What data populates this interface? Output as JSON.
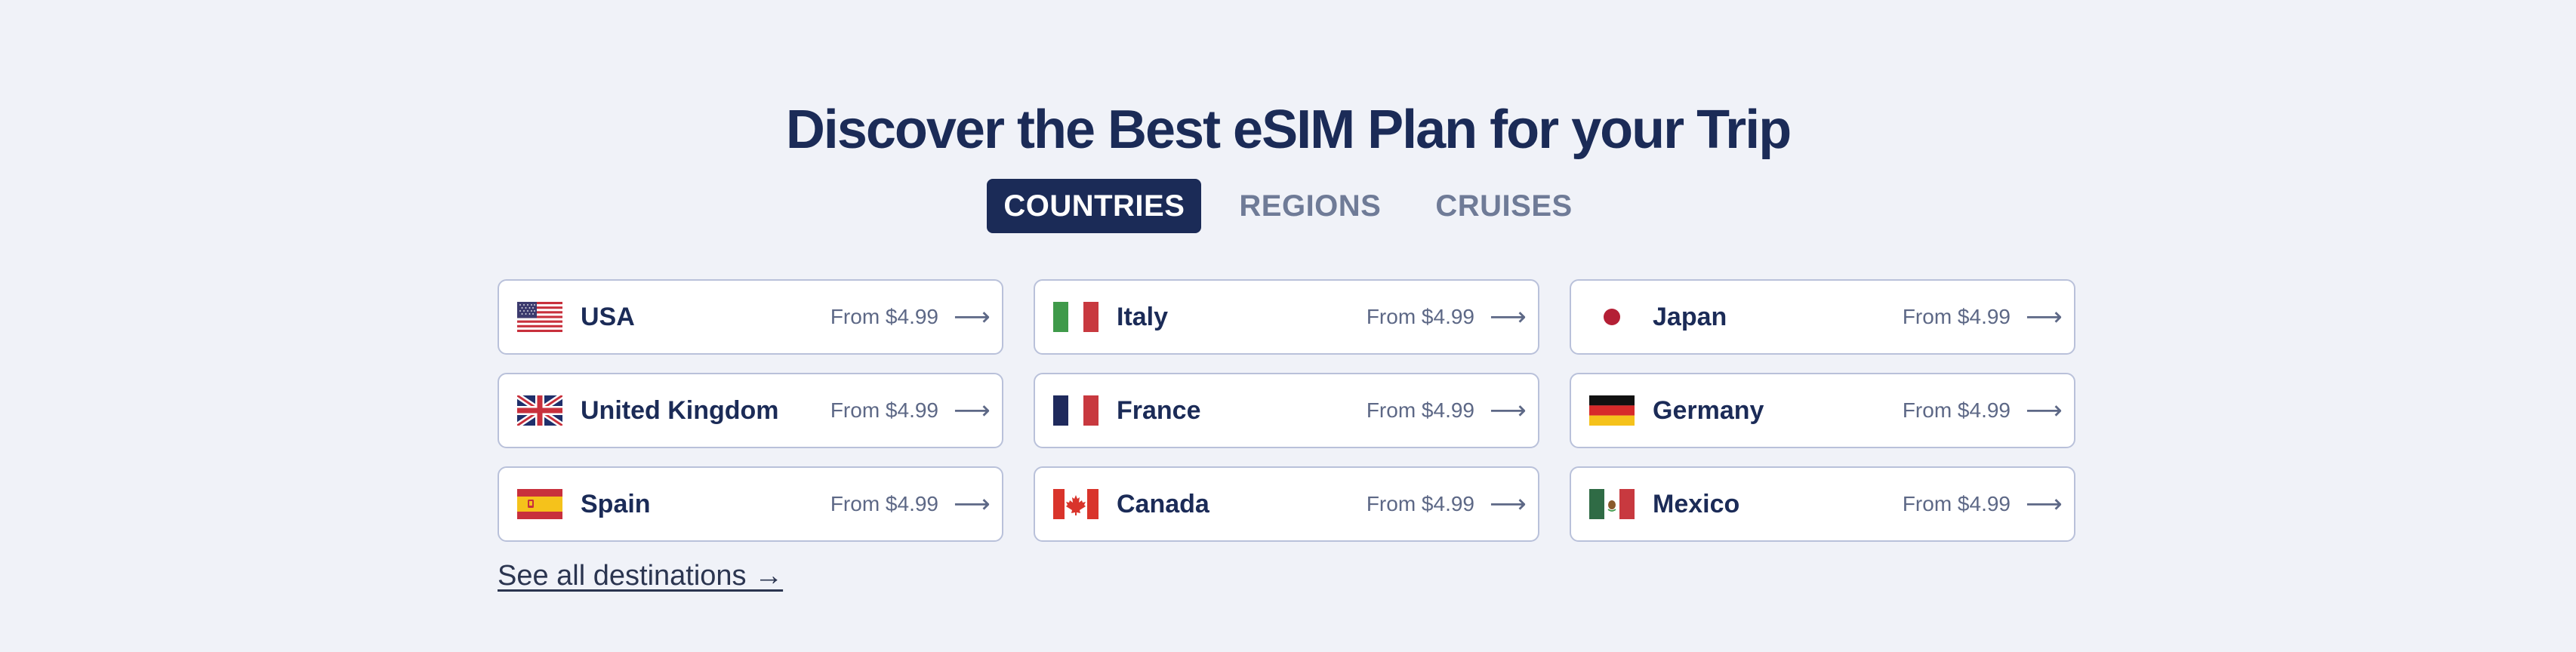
{
  "section": {
    "title": "Discover the Best eSIM Plan for your Trip"
  },
  "tabs": [
    {
      "label": "COUNTRIES",
      "active": true
    },
    {
      "label": "REGIONS",
      "active": false
    },
    {
      "label": "CRUISES",
      "active": false
    }
  ],
  "destinations": [
    {
      "name": "USA",
      "price": "From $4.99",
      "flag": "usa-flag-icon"
    },
    {
      "name": "Italy",
      "price": "From $4.99",
      "flag": "italy-flag-icon"
    },
    {
      "name": "Japan",
      "price": "From $4.99",
      "flag": "japan-flag-icon"
    },
    {
      "name": "United Kingdom",
      "price": "From $4.99",
      "flag": "uk-flag-icon"
    },
    {
      "name": "France",
      "price": "From $4.99",
      "flag": "france-flag-icon"
    },
    {
      "name": "Germany",
      "price": "From $4.99",
      "flag": "germany-flag-icon"
    },
    {
      "name": "Spain",
      "price": "From $4.99",
      "flag": "spain-flag-icon"
    },
    {
      "name": "Canada",
      "price": "From $4.99",
      "flag": "canada-flag-icon"
    },
    {
      "name": "Mexico",
      "price": "From $4.99",
      "flag": "mexico-flag-icon"
    }
  ],
  "arrow_glyph": "⟶",
  "see_all": "See all destinations →",
  "colors": {
    "background": "#f0f2f8",
    "navy": "#1b2b57",
    "card_border": "#b9c1da",
    "muted": "#6f7b97"
  }
}
